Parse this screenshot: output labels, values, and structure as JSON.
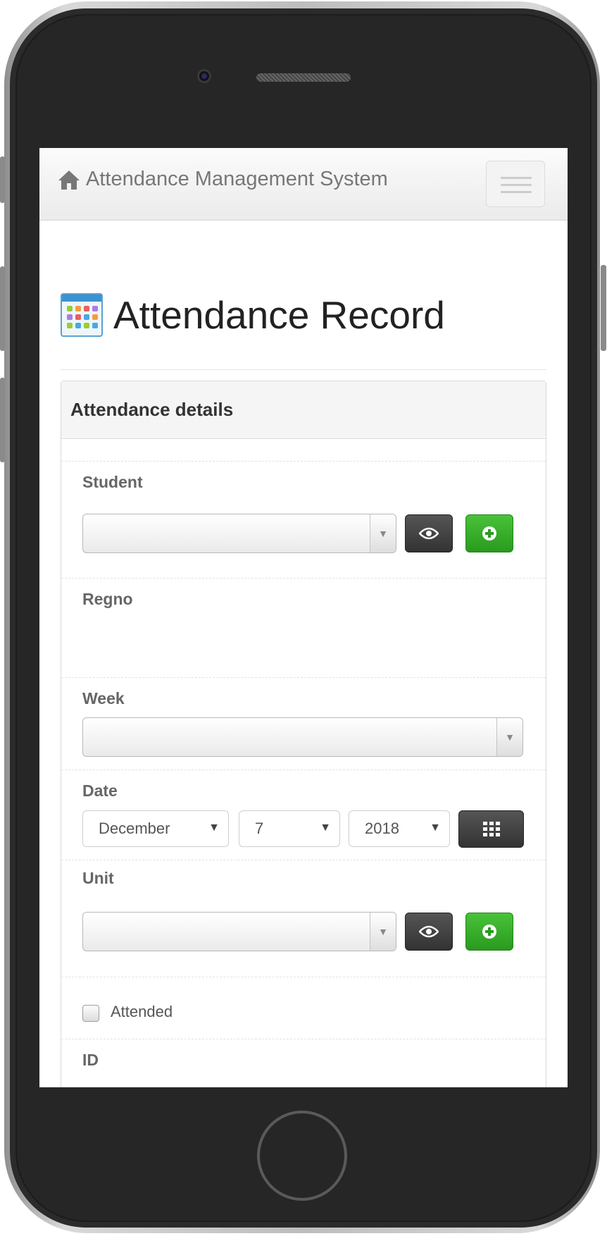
{
  "navbar": {
    "brand_icon": "home-icon",
    "brand": "Attendance Management System",
    "toggle_icon": "hamburger-menu-icon"
  },
  "page": {
    "icon": "calendar-icon",
    "title": "Attendance Record"
  },
  "panel": {
    "heading": "Attendance details",
    "student": {
      "label": "Student",
      "value": "",
      "view_icon": "eye-icon",
      "add_icon": "plus-circle-icon"
    },
    "regno": {
      "label": "Regno",
      "value": ""
    },
    "week": {
      "label": "Week",
      "value": ""
    },
    "date": {
      "label": "Date",
      "month": "December",
      "day": "7",
      "year": "2018",
      "calendar_icon": "grid-calendar-icon"
    },
    "unit": {
      "label": "Unit",
      "value": "",
      "view_icon": "eye-icon",
      "add_icon": "plus-circle-icon"
    },
    "attended": {
      "label": "Attended",
      "checked": false
    },
    "id": {
      "label": "ID"
    }
  },
  "colors": {
    "primary_dark_button": "#3f3f3f",
    "success_button": "#34ab27",
    "phone_bezel": "#2b2b2b"
  }
}
